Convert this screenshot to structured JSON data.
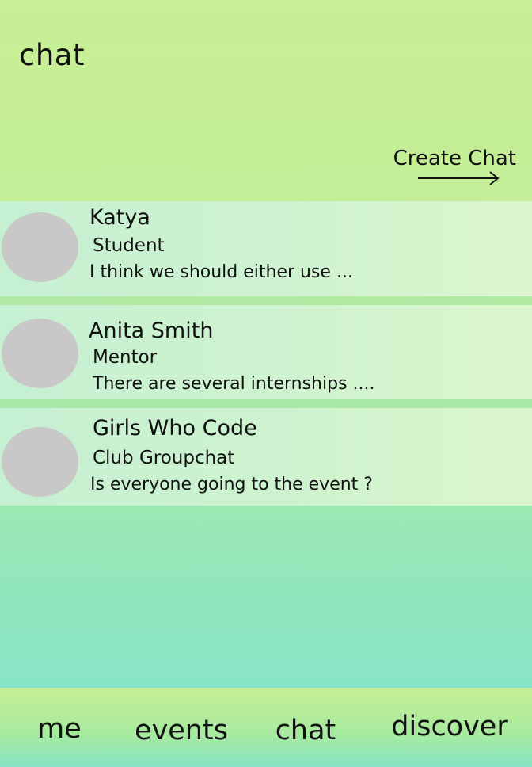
{
  "header": {
    "title": "chat",
    "create_chat_label": "Create Chat"
  },
  "chats": [
    {
      "name": "Katya",
      "role": "Student",
      "preview": "I think we should either use ..."
    },
    {
      "name": "Anita Smith",
      "role": "Mentor",
      "preview": "There are several internships ...."
    },
    {
      "name": "Girls Who Code",
      "role": "Club Groupchat",
      "preview": "Is everyone going to the event ?"
    }
  ],
  "bottom_nav": {
    "tabs": [
      {
        "label": "me"
      },
      {
        "label": "events"
      },
      {
        "label": "chat"
      },
      {
        "label": "discover"
      }
    ]
  },
  "colors": {
    "avatar_placeholder": "#c8c8c8",
    "header_background": "#c7ef95",
    "row_background": "#cdf2cf",
    "page_background_bottom": "#7fe3cf"
  },
  "icons": {
    "create_chat": "arrow-right-icon"
  }
}
